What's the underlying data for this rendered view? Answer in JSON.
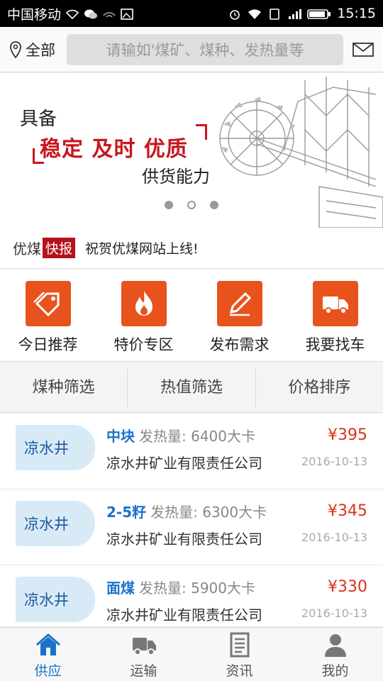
{
  "status_bar": {
    "carrier": "中国移动",
    "time": "15:15",
    "icons": [
      "wifi-icon",
      "wechat-icon",
      "signal-icon",
      "image-icon",
      "alarm-icon",
      "wifi-icon",
      "sim-icon",
      "signal-bars-icon",
      "battery-icon"
    ]
  },
  "header": {
    "location_label": "全部",
    "search_placeholder": "请输如'煤矿、煤种、发热量等",
    "icons": [
      "location-pin-icon",
      "mail-icon"
    ]
  },
  "banner": {
    "line1": "具备",
    "line2": "稳定 及时 优质",
    "line3": "供货能力",
    "accent_color": "#c8161d",
    "slide_count": 3,
    "current_slide": 1
  },
  "news": {
    "brand": "优煤",
    "tag": "快报",
    "text": "祝贺优煤网站上线!"
  },
  "categories": [
    {
      "label": "今日推荐",
      "icon": "tag-icon"
    },
    {
      "label": "特价专区",
      "icon": "fire-icon"
    },
    {
      "label": "发布需求",
      "icon": "pencil-icon"
    },
    {
      "label": "我要找车",
      "icon": "truck-icon"
    }
  ],
  "filters": [
    "煤种筛选",
    "热值筛选",
    "价格排序"
  ],
  "listings": [
    {
      "mine": "凉水井",
      "type": "中块",
      "heat": "发热量: 6400大卡",
      "company": "凉水井矿业有限责任公司",
      "price": "¥395",
      "date": "2016-10-13"
    },
    {
      "mine": "凉水井",
      "type": "2-5籽",
      "heat": "发热量: 6300大卡",
      "company": "凉水井矿业有限责任公司",
      "price": "¥345",
      "date": "2016-10-13"
    },
    {
      "mine": "凉水井",
      "type": "面煤",
      "heat": "发热量: 5900大卡",
      "company": "凉水井矿业有限责任公司",
      "price": "¥330",
      "date": "2016-10-13"
    }
  ],
  "tabs": [
    {
      "label": "供应",
      "icon": "home-icon",
      "active": true
    },
    {
      "label": "运输",
      "icon": "truck-icon",
      "active": false
    },
    {
      "label": "资讯",
      "icon": "document-icon",
      "active": false
    },
    {
      "label": "我的",
      "icon": "user-icon",
      "active": false
    }
  ],
  "colors": {
    "accent": "#e8531d",
    "primary": "#1a72c8",
    "price": "#d9341a"
  }
}
